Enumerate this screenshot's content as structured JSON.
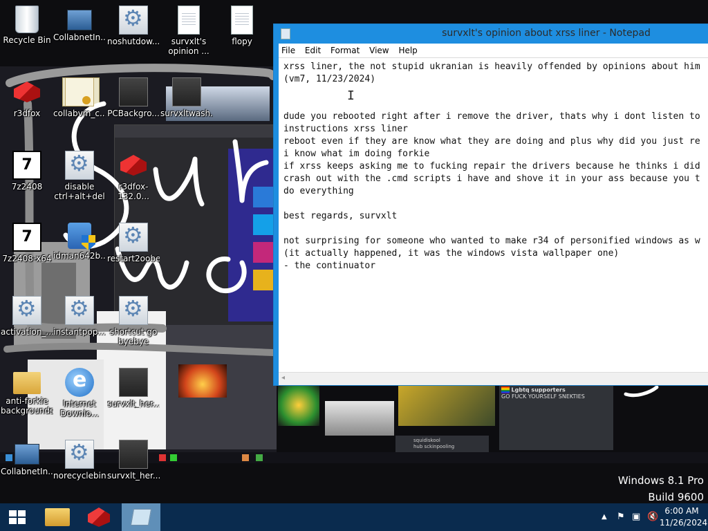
{
  "desktop": {
    "icons": [
      {
        "label": "Recycle Bin"
      },
      {
        "label": "CollabnetIn..."
      },
      {
        "label": "noshutdow..."
      },
      {
        "label": "survxlt's\nopinion ..."
      },
      {
        "label": "flopy"
      },
      {
        "label": "r3dfox"
      },
      {
        "label": "collabvm_c..."
      },
      {
        "label": "PCBackgro..."
      },
      {
        "label": "survxltwash..."
      },
      {
        "label": "7z2408"
      },
      {
        "label": "disable\nctrl+alt+del"
      },
      {
        "label": "r3dfox-132.0..."
      },
      {
        "label": "7z2408-x64"
      },
      {
        "label": "idman642b..."
      },
      {
        "label": "restart2oobe"
      },
      {
        "label": "activation_..."
      },
      {
        "label": "instantpop..."
      },
      {
        "label": "shortcut go\nbyebye"
      },
      {
        "label": "anti-forkie\nbackgrounds"
      },
      {
        "label": "Internet\nDownlo..."
      },
      {
        "label": "survxlt_her..."
      },
      {
        "label": "CollabnetIn..."
      },
      {
        "label": "norecyclebin"
      },
      {
        "label": "survxlt_her..."
      }
    ]
  },
  "wallpaper": {
    "discord_header": "Lgbtq supporters",
    "discord_sub": "GO FUCK YOURSELF SNEKTIES",
    "message_user": "squidiskool",
    "message_text": "hub sckinpooling"
  },
  "notepad": {
    "title": "survxlt's opinion about xrss liner - Notepad",
    "menu": [
      "File",
      "Edit",
      "Format",
      "View",
      "Help"
    ],
    "content": "xrss liner, the not stupid ukranian is heavily offended by opinions about him\n(vm7, 11/23/2024)\n\n\ndude you rebooted right after i remove the driver, thats why i dont listen to\ninstructions xrss liner\nreboot even if they are know what they are doing and plus why did you just re\ni know what im doing forkie\nif xrss keeps asking me to fucking repair the drivers because he thinks i did\ncrash out with the .cmd scripts i have and shove it in your ass because you t\ndo everything\n\nbest regards, survxlt\n\nnot surprising for someone who wanted to make r34 of personified windows as w\n(it actually happened, it was the windows vista wallpaper one)\n- the continuator"
  },
  "watermark": {
    "line1": "Windows 8.1 Pro",
    "line2": "Build 9600"
  },
  "taskbar": {
    "pinned": [
      {
        "name": "file-explorer",
        "icon": "folder-icon"
      },
      {
        "name": "r3dfox",
        "icon": "r3dfox-icon"
      },
      {
        "name": "notepad",
        "icon": "notepad-icon",
        "active": true
      }
    ],
    "clock": {
      "time": "6:00 AM",
      "date": "11/26/2024"
    },
    "tray_icons": [
      "chevron-up-icon",
      "flag-icon",
      "network-icon",
      "volume-muted-icon"
    ]
  },
  "colors": {
    "taskbar": "#0a2b4e",
    "notepad_frame": "#1e8ee0",
    "scribble": "#ffffff"
  }
}
